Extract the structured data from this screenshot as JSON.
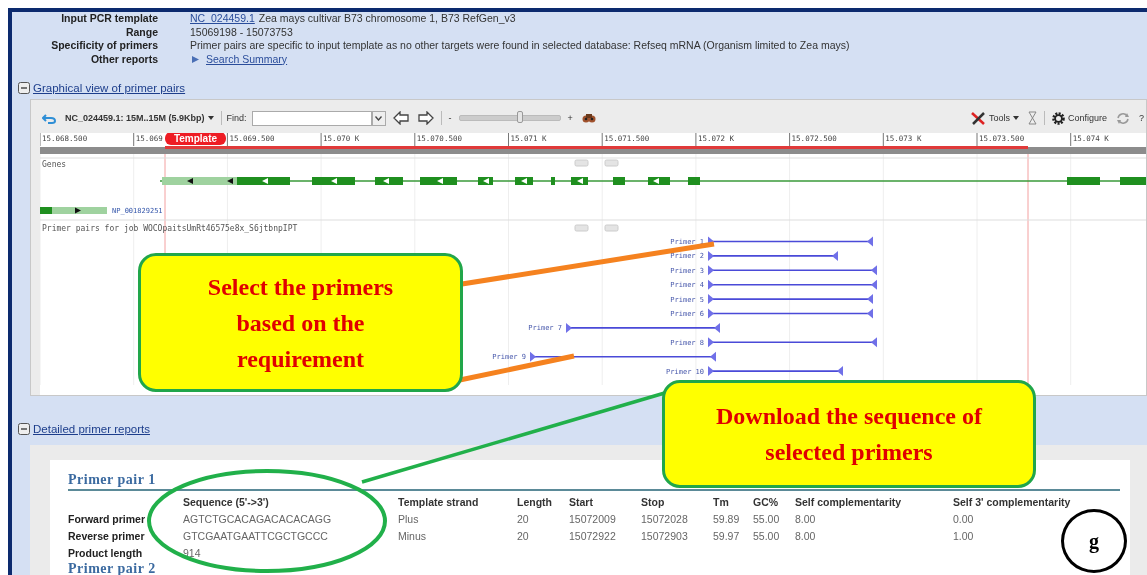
{
  "summary": [
    {
      "kind": "text",
      "label": "Input PCR template",
      "link": "NC_024459.1",
      "value": "Zea mays cultivar B73 chromosome 1, B73 RefGen_v3"
    },
    {
      "kind": "text",
      "label": "Range",
      "value": "15069198 - 15073753"
    },
    {
      "kind": "text",
      "label": "Specificity of primers",
      "value": "Primer pairs are specific to input template as no other targets were found in selected database: Refseq mRNA (Organism limited to Zea mays)"
    },
    {
      "kind": "expand_link",
      "label": "Other reports",
      "link": "Search Summary"
    }
  ],
  "graphical_section": {
    "title": "Graphical view of primer pairs",
    "expanded": true
  },
  "viewer": {
    "sequence_menu": "NC_024459.1: 15M..15M (5.9Kbp)",
    "find_label": "Find:",
    "zoom_out": "-",
    "zoom_in": "+",
    "zoom": {
      "level": 0.6
    },
    "tools": "Tools",
    "configure": "Configure",
    "help": "?",
    "ruler": [
      "15.068.500",
      "15.069",
      "15.069.500",
      "15.070 K",
      "15.070.500",
      "15.071 K",
      "15.071.500",
      "15.072 K",
      "15.072.500",
      "15.073 K",
      "15.073.500",
      "15.074 K"
    ],
    "template_label": "Template",
    "genes_track": "Genes",
    "gene_label": "NP_001829251",
    "primer_track": "Primer pairs for job WOCOpaitsUmRt46575e8x_S6jtbnpIPT",
    "primers": [
      {
        "label": "Primer 1"
      },
      {
        "label": "Primer 2"
      },
      {
        "label": "Primer 3"
      },
      {
        "label": "Primer 4"
      },
      {
        "label": "Primer 5"
      },
      {
        "label": "Primer 6"
      },
      {
        "label": "Primer 7"
      },
      {
        "label": "Primer 8"
      },
      {
        "label": "Primer 9"
      },
      {
        "label": "Primer 10"
      }
    ]
  },
  "report_section": {
    "title": "Detailed primer reports",
    "expanded": true,
    "pairs": [
      {
        "title": "Primer pair 1",
        "columns": [
          "Sequence (5'->3')",
          "Template strand",
          "Length",
          "Start",
          "Stop",
          "Tm",
          "GC%",
          "Self complementarity",
          "Self 3' complementarity"
        ],
        "rows": [
          {
            "label": "Forward primer",
            "cells": [
              "AGTCTGCACAGACACACAGG",
              "Plus",
              "20",
              "15072009",
              "15072028",
              "59.89",
              "55.00",
              "8.00",
              "0.00"
            ]
          },
          {
            "label": "Reverse primer",
            "cells": [
              "GTCGAATGAATTCGCTGCCC",
              "Minus",
              "20",
              "15072922",
              "15072903",
              "59.97",
              "55.00",
              "8.00",
              "1.00"
            ]
          },
          {
            "label": "Product length",
            "cells": [
              "914"
            ]
          }
        ]
      },
      {
        "title": "Primer pair 2"
      }
    ]
  },
  "annotations": [
    {
      "text": "Select the primers based on the requirement"
    },
    {
      "text": "Download the sequence of selected primers"
    }
  ],
  "figure_label": "g"
}
